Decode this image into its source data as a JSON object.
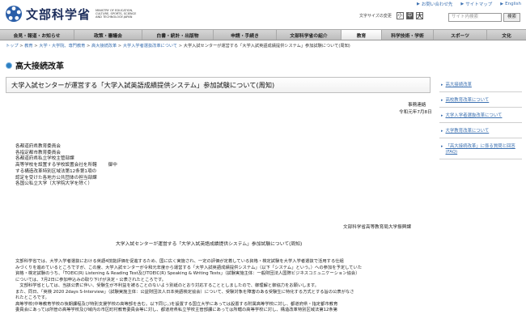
{
  "header": {
    "logo_jp": "文部科学省",
    "logo_en": "MINISTRY OF EDUCATION, CULTURE, SPORTS, SCIENCE AND TECHNOLOGY-JAPAN",
    "util_links": [
      "お問い合わせ先",
      "サイトマップ",
      "English"
    ],
    "size_label": "文字サイズの変更",
    "size_small": "小",
    "size_medium": "中",
    "size_large": "大",
    "search_placeholder": "サイト内検索",
    "search_button": "検索"
  },
  "nav": {
    "items": [
      {
        "label": "会見・報道・お知らせ"
      },
      {
        "label": "政策・審議会"
      },
      {
        "label": "白書・統計・出版物"
      },
      {
        "label": "申請・手続き"
      },
      {
        "label": "文部科学省の紹介"
      },
      {
        "label": "教育"
      },
      {
        "label": "科学技術・学術"
      },
      {
        "label": "スポーツ"
      },
      {
        "label": "文化"
      }
    ]
  },
  "breadcrumb": {
    "items": [
      "トップ",
      "教育",
      "大学・大学院、専門教育",
      "高大接続改革",
      "大学入学者選抜改革について"
    ],
    "current": "大学入試センターが運営する「大学入試英語成績提供システム」参加試験について(周知)"
  },
  "page": {
    "title": "高大接続改革"
  },
  "article": {
    "title": "大学入試センターが運営する「大学入試英語成績提供システム」参加試験について(周知)",
    "meta_1": "事務連絡",
    "meta_2": "令和元年7月8日",
    "recipients": [
      "各都道府県教育委員会",
      "各指定都市教育委員会",
      "各都道府県私立学校主管部課",
      "高等学校を設置する学校設置会社を所轄",
      "する構造改革特別区域法第12条第1項の",
      "認定を受けた各地方公共団体の担当部課",
      "各国公私立大学（大学院大学を除く）"
    ],
    "recipients_suffix": "御中",
    "sender": "文部科学省高等教育局大学振興課",
    "subject": "大学入試センターが運営する「大学入試英語成績提供システム」参加試験について(周知)",
    "body": [
      "文部科学省では、大学入学者選抜における英語4技能評価を促進するため、国に広く実施され、一定の評価が定着している資格・検定試験を大学入学者選抜で活用する仕組",
      "みづくりを進めているところですが、この度、大学入試センターが令和元年度から運営する「大学入試英語成績提供システム」（以下「システム」という。）への参加を予定していた",
      "資格・検定試験のうち、「TOEIC(R) Listening & Reading Test及びTOEIC(R) Speaking & Writing Tests」（試験実施主体：一般財団法人国際ビジネスコミュニケーション協会）",
      "については、7月2日に参加申込みの取り下げが決定・公表されたところです。",
      "　文部科学省としては、当該公表に伴い、受験生が不利益を被ることのないよう別紙のとおり対応することとしましたので、御理解と御協力をお願いします。",
      "また、同日、「英検 2020 2days S-Interview」（試験実施主体：公益財団法人日本英語検定協会）について、受験対象を障害のある受験生に特化する方式とする旨の公表がなさ",
      "れたところです。",
      "高等学校(中等教育学校の後期課程及び特別支援学校の高等部を含む。以下同じ。)を設置する国立大学にあっては設置する附属高等学校に対し、都道府県・指定都市教育",
      "委員会にあっては所管の高等学校及び域内の市区町村教育委員会等に対し、都道府県私立学校主管部課にあっては所轄の高等学校に対し、構造改革特別区域法第12条第"
    ]
  },
  "sidebar": {
    "items": [
      {
        "label": "高大接続改革"
      },
      {
        "label": "高校教育改革について"
      },
      {
        "label": "大学入学者選抜改革について"
      },
      {
        "label": "大学教育改革について"
      },
      {
        "label": "「高大接続改革」に係る質問と回答(FAQ)"
      }
    ]
  },
  "colors": {
    "accent_blue": "#2d7fc1",
    "link": "#3a6fb0",
    "nav_bg": "#c8c8c8"
  }
}
